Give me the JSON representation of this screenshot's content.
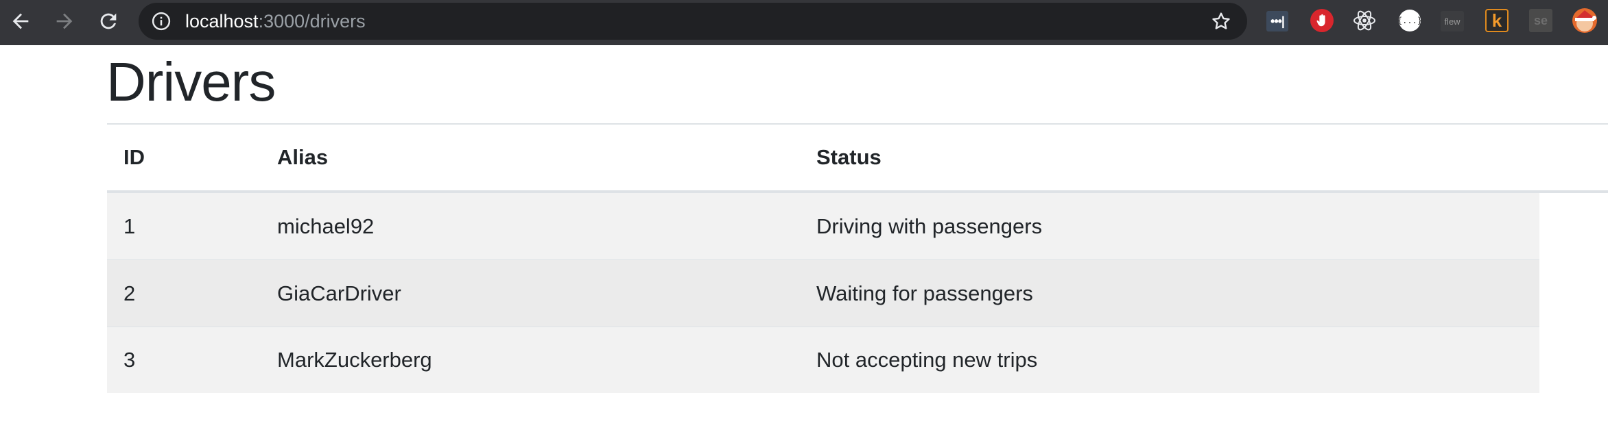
{
  "browser": {
    "url_host": "localhost",
    "url_path": ":3000/drivers",
    "extensions": [
      {
        "name": "ublock-dots-icon",
        "label": "•••|"
      },
      {
        "name": "adblock-stop-icon",
        "label": ""
      },
      {
        "name": "react-devtools-icon",
        "label": ""
      },
      {
        "name": "json-viewer-icon",
        "label": "{...}"
      },
      {
        "name": "flew-icon",
        "label": "flew"
      },
      {
        "name": "k-extension-icon",
        "label": "k"
      },
      {
        "name": "se-extension-icon",
        "label": "se"
      },
      {
        "name": "profile-avatar-icon",
        "label": ""
      }
    ]
  },
  "page": {
    "title": "Drivers"
  },
  "table": {
    "columns": [
      "ID",
      "Alias",
      "Status"
    ],
    "rows": [
      {
        "id": "1",
        "alias": "michael92",
        "status": "Driving with passengers"
      },
      {
        "id": "2",
        "alias": "GiaCarDriver",
        "status": "Waiting for passengers"
      },
      {
        "id": "3",
        "alias": "MarkZuckerberg",
        "status": "Not accepting new trips"
      }
    ]
  },
  "colors": {
    "toolbar": "#35363a",
    "omnibox": "#202124",
    "row_odd": "#f2f2f2",
    "row_even": "#ebebeb",
    "text": "#212529"
  }
}
